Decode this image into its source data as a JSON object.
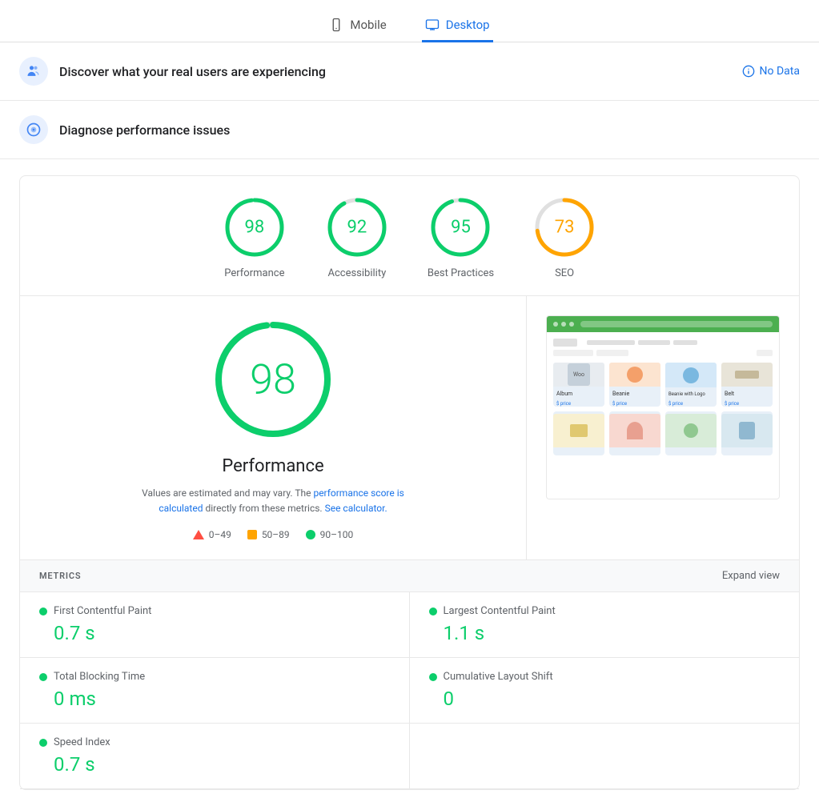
{
  "tabs": [
    {
      "id": "mobile",
      "label": "Mobile",
      "active": false
    },
    {
      "id": "desktop",
      "label": "Desktop",
      "active": true
    }
  ],
  "banners": {
    "real_users": {
      "title": "Discover what your real users are experiencing",
      "no_data_label": "No Data"
    },
    "diagnose": {
      "title": "Diagnose performance issues"
    }
  },
  "scores": [
    {
      "id": "performance",
      "value": 98,
      "label": "Performance",
      "color": "#0cce6b",
      "bg": "#e6faf1"
    },
    {
      "id": "accessibility",
      "value": 92,
      "label": "Accessibility",
      "color": "#0cce6b",
      "bg": "#e6faf1"
    },
    {
      "id": "best-practices",
      "value": 95,
      "label": "Best Practices",
      "color": "#0cce6b",
      "bg": "#e6faf1"
    },
    {
      "id": "seo",
      "value": 73,
      "label": "SEO",
      "color": "#ffa400",
      "bg": "#fff8e1"
    }
  ],
  "main_score": {
    "value": 98,
    "label": "Performance",
    "description": "Values are estimated and may vary. The",
    "link1": "performance score is calculated",
    "description2": "directly from these metrics.",
    "link2": "See calculator.",
    "color": "#0cce6b"
  },
  "legend": [
    {
      "type": "triangle",
      "range": "0–49"
    },
    {
      "type": "square",
      "range": "50–89"
    },
    {
      "type": "dot",
      "color": "#0cce6b",
      "range": "90–100"
    }
  ],
  "metrics_header": {
    "title": "METRICS",
    "expand_label": "Expand view"
  },
  "metrics": [
    {
      "id": "fcp",
      "name": "First Contentful Paint",
      "value": "0.7 s",
      "color": "#0cce6b"
    },
    {
      "id": "lcp",
      "name": "Largest Contentful Paint",
      "value": "1.1 s",
      "color": "#0cce6b"
    },
    {
      "id": "tbt",
      "name": "Total Blocking Time",
      "value": "0 ms",
      "color": "#0cce6b"
    },
    {
      "id": "cls",
      "name": "Cumulative Layout Shift",
      "value": "0",
      "color": "#0cce6b"
    },
    {
      "id": "si",
      "name": "Speed Index",
      "value": "0.7 s",
      "color": "#0cce6b"
    }
  ],
  "screenshot": {
    "products": [
      {
        "name": "Album",
        "badge": true
      },
      {
        "name": "Beanie",
        "badge": true
      },
      {
        "name": "Beanie with Logo",
        "badge": true
      },
      {
        "name": "Belt",
        "badge": true
      },
      {
        "name": "",
        "badge": true
      },
      {
        "name": "",
        "badge": true
      },
      {
        "name": "",
        "badge": true
      },
      {
        "name": "",
        "badge": false
      }
    ]
  }
}
